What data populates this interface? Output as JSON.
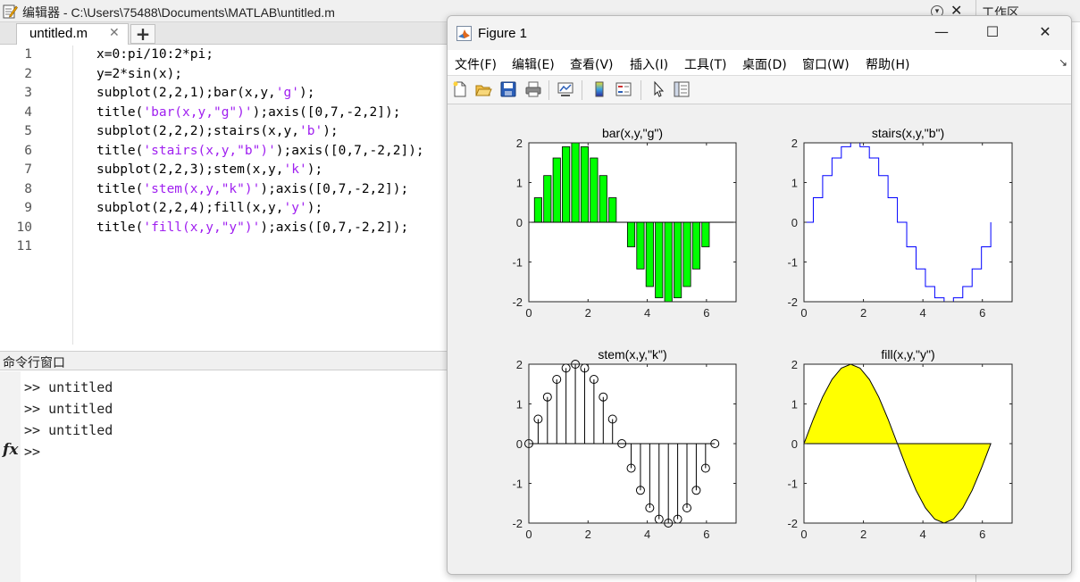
{
  "editor": {
    "title": "编辑器 - C:\\Users\\75488\\Documents\\MATLAB\\untitled.m",
    "tab_label": "untitled.m",
    "tab_close": "✕",
    "tab_add": "+",
    "workspace_title": "工作区",
    "lines": [
      {
        "n": "1",
        "parts": [
          {
            "t": "x=0:pi/10:2*pi;",
            "s": false
          }
        ]
      },
      {
        "n": "2",
        "parts": [
          {
            "t": "y=2*sin(x);",
            "s": false
          }
        ]
      },
      {
        "n": "3",
        "parts": [
          {
            "t": "subplot(2,2,1);bar(x,y,",
            "s": false
          },
          {
            "t": "'g'",
            "s": true
          },
          {
            "t": ");",
            "s": false
          }
        ]
      },
      {
        "n": "4",
        "parts": [
          {
            "t": "title(",
            "s": false
          },
          {
            "t": "'bar(x,y,\"g\")'",
            "s": true
          },
          {
            "t": ");axis([0,7,-2,2]);",
            "s": false
          }
        ]
      },
      {
        "n": "5",
        "parts": [
          {
            "t": "subplot(2,2,2);stairs(x,y,",
            "s": false
          },
          {
            "t": "'b'",
            "s": true
          },
          {
            "t": ");",
            "s": false
          }
        ]
      },
      {
        "n": "6",
        "parts": [
          {
            "t": "title(",
            "s": false
          },
          {
            "t": "'stairs(x,y,\"b\")'",
            "s": true
          },
          {
            "t": ");axis([0,7,-2,2]);",
            "s": false
          }
        ]
      },
      {
        "n": "7",
        "parts": [
          {
            "t": "subplot(2,2,3);stem(x,y,",
            "s": false
          },
          {
            "t": "'k'",
            "s": true
          },
          {
            "t": ");",
            "s": false
          }
        ]
      },
      {
        "n": "8",
        "parts": [
          {
            "t": "title(",
            "s": false
          },
          {
            "t": "'stem(x,y,\"k\")'",
            "s": true
          },
          {
            "t": ");axis([0,7,-2,2]);",
            "s": false
          }
        ]
      },
      {
        "n": "9",
        "parts": [
          {
            "t": "subplot(2,2,4);fill(x,y,",
            "s": false
          },
          {
            "t": "'y'",
            "s": true
          },
          {
            "t": ");",
            "s": false
          }
        ]
      },
      {
        "n": "10",
        "parts": [
          {
            "t": "title(",
            "s": false
          },
          {
            "t": "'fill(x,y,\"y\")'",
            "s": true
          },
          {
            "t": ");axis([0,7,-2,2]);",
            "s": false
          }
        ]
      },
      {
        "n": "11",
        "parts": []
      }
    ]
  },
  "command_window": {
    "title": "命令行窗口",
    "history": [
      ">> untitled",
      ">> untitled",
      ">> untitled"
    ],
    "prompt": ">>",
    "fx": "fx"
  },
  "figure": {
    "title": "Figure 1",
    "controls": {
      "minimize": "—",
      "maximize": "☐",
      "close": "✕"
    },
    "menu": [
      "文件(F)",
      "编辑(E)",
      "查看(V)",
      "插入(I)",
      "工具(T)",
      "桌面(D)",
      "窗口(W)",
      "帮助(H)"
    ],
    "toolbar_icons": [
      "new-figure-icon",
      "open-file-icon",
      "save-icon",
      "print-icon",
      "link-plot-icon",
      "colorbar-icon",
      "legend-icon",
      "pointer-icon",
      "property-editor-icon"
    ]
  },
  "colors": {
    "bar": "#00ff00",
    "stairs": "#0000ff",
    "stem": "#000000",
    "fill": "#ffff00",
    "string": "#a020f0"
  },
  "chart_data": [
    {
      "type": "bar",
      "title": "bar(x,y,\"g\")",
      "x": [
        0,
        0.3142,
        0.6283,
        0.9425,
        1.2566,
        1.5708,
        1.885,
        2.1991,
        2.5133,
        2.8274,
        3.1416,
        3.4558,
        3.7699,
        4.0841,
        4.3982,
        4.7124,
        5.0265,
        5.3407,
        5.6549,
        5.969,
        6.2832
      ],
      "y": [
        0,
        0.618,
        1.1756,
        1.618,
        1.9021,
        2,
        1.9021,
        1.618,
        1.1756,
        0.618,
        0,
        -0.618,
        -1.1756,
        -1.618,
        -1.9021,
        -2,
        -1.9021,
        -1.618,
        -1.1756,
        -0.618,
        0
      ],
      "xlim": [
        0,
        7
      ],
      "ylim": [
        -2,
        2
      ],
      "xticks": [
        "0",
        "2",
        "4",
        "6"
      ],
      "yticks": [
        "2",
        "1",
        "0",
        "-1",
        "-2"
      ],
      "color": "#00ff00"
    },
    {
      "type": "line",
      "style": "stairs",
      "title": "stairs(x,y,\"b\")",
      "x": [
        0,
        0.3142,
        0.6283,
        0.9425,
        1.2566,
        1.5708,
        1.885,
        2.1991,
        2.5133,
        2.8274,
        3.1416,
        3.4558,
        3.7699,
        4.0841,
        4.3982,
        4.7124,
        5.0265,
        5.3407,
        5.6549,
        5.969,
        6.2832
      ],
      "y": [
        0,
        0.618,
        1.1756,
        1.618,
        1.9021,
        2,
        1.9021,
        1.618,
        1.1756,
        0.618,
        0,
        -0.618,
        -1.1756,
        -1.618,
        -1.9021,
        -2,
        -1.9021,
        -1.618,
        -1.1756,
        -0.618,
        0
      ],
      "xlim": [
        0,
        7
      ],
      "ylim": [
        -2,
        2
      ],
      "xticks": [
        "0",
        "2",
        "4",
        "6"
      ],
      "yticks": [
        "2",
        "1",
        "0",
        "-1",
        "-2"
      ],
      "color": "#0000ff"
    },
    {
      "type": "scatter",
      "style": "stem",
      "title": "stem(x,y,\"k\")",
      "x": [
        0,
        0.3142,
        0.6283,
        0.9425,
        1.2566,
        1.5708,
        1.885,
        2.1991,
        2.5133,
        2.8274,
        3.1416,
        3.4558,
        3.7699,
        4.0841,
        4.3982,
        4.7124,
        5.0265,
        5.3407,
        5.6549,
        5.969,
        6.2832
      ],
      "y": [
        0,
        0.618,
        1.1756,
        1.618,
        1.9021,
        2,
        1.9021,
        1.618,
        1.1756,
        0.618,
        0,
        -0.618,
        -1.1756,
        -1.618,
        -1.9021,
        -2,
        -1.9021,
        -1.618,
        -1.1756,
        -0.618,
        0
      ],
      "xlim": [
        0,
        7
      ],
      "ylim": [
        -2,
        2
      ],
      "xticks": [
        "0",
        "2",
        "4",
        "6"
      ],
      "yticks": [
        "2",
        "1",
        "0",
        "-1",
        "-2"
      ],
      "color": "#000000"
    },
    {
      "type": "area",
      "style": "fill",
      "title": "fill(x,y,\"y\")",
      "x": [
        0,
        0.3142,
        0.6283,
        0.9425,
        1.2566,
        1.5708,
        1.885,
        2.1991,
        2.5133,
        2.8274,
        3.1416,
        3.4558,
        3.7699,
        4.0841,
        4.3982,
        4.7124,
        5.0265,
        5.3407,
        5.6549,
        5.969,
        6.2832
      ],
      "y": [
        0,
        0.618,
        1.1756,
        1.618,
        1.9021,
        2,
        1.9021,
        1.618,
        1.1756,
        0.618,
        0,
        -0.618,
        -1.1756,
        -1.618,
        -1.9021,
        -2,
        -1.9021,
        -1.618,
        -1.1756,
        -0.618,
        0
      ],
      "xlim": [
        0,
        7
      ],
      "ylim": [
        -2,
        2
      ],
      "xticks": [
        "0",
        "2",
        "4",
        "6"
      ],
      "yticks": [
        "2",
        "1",
        "0",
        "-1",
        "-2"
      ],
      "color": "#ffff00"
    }
  ]
}
